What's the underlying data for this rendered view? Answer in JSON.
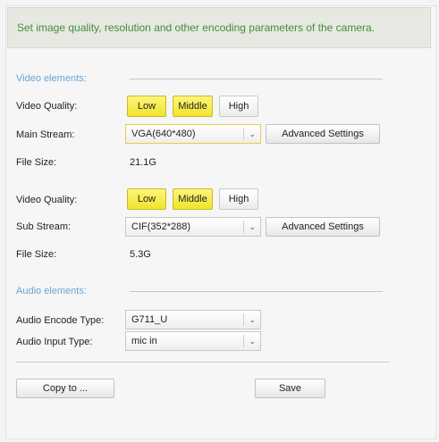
{
  "description": "Set image quality, resolution and other encoding parameters of the camera.",
  "video_section": {
    "title": "Video elements:"
  },
  "main": {
    "quality_label": "Video Quality:",
    "quality_options": {
      "low": "Low",
      "middle": "Middle",
      "high": "High"
    },
    "quality_selected": [
      "Low",
      "Middle"
    ],
    "stream_label": "Main Stream:",
    "stream_value": "VGA(640*480)",
    "advanced_label": "Advanced Settings",
    "file_size_label": "File Size:",
    "file_size_value": "21.1G"
  },
  "sub": {
    "quality_label": "Video Quality:",
    "quality_options": {
      "low": "Low",
      "middle": "Middle",
      "high": "High"
    },
    "quality_selected": [
      "Low",
      "Middle"
    ],
    "stream_label": "Sub Stream:",
    "stream_value": "CIF(352*288)",
    "advanced_label": "Advanced Settings",
    "file_size_label": "File Size:",
    "file_size_value": "5.3G"
  },
  "audio_section": {
    "title": "Audio elements:"
  },
  "audio": {
    "encode_label": "Audio Encode Type:",
    "encode_value": "G711_U",
    "input_label": "Audio Input Type:",
    "input_value": "mic in"
  },
  "actions": {
    "copy_label": "Copy to ...",
    "save_label": "Save"
  },
  "colors": {
    "description_text": "#3f8f35",
    "section_title": "#6aa3d8",
    "button_active": "#f1e32d"
  },
  "icons": {
    "select_arrow": "chevron-down-icon"
  }
}
